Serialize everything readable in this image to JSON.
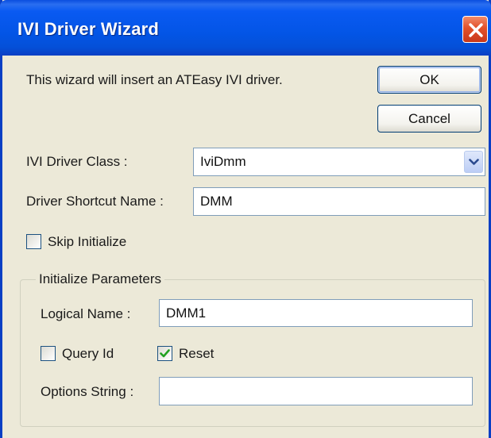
{
  "window": {
    "title": "IVI Driver Wizard"
  },
  "intro_text": "This wizard will insert an ATEasy IVI driver.",
  "buttons": {
    "ok": "OK",
    "cancel": "Cancel"
  },
  "driver_class": {
    "label": "IVI Driver Class :",
    "value": "IviDmm"
  },
  "shortcut_name": {
    "label": "Driver Shortcut Name :",
    "value": "DMM"
  },
  "skip_initialize": {
    "label": "Skip Initialize",
    "checked": false
  },
  "initialize_parameters": {
    "title": "Initialize Parameters",
    "logical_name": {
      "label": "Logical Name :",
      "value": "DMM1"
    },
    "query_id": {
      "label": "Query Id",
      "checked": false
    },
    "reset": {
      "label": "Reset",
      "checked": true
    },
    "options_string": {
      "label": "Options String :",
      "value": ""
    }
  },
  "colors": {
    "titlebar": "#0355e6",
    "window_bg": "#ece9d8",
    "close_button": "#e2512a",
    "checkmark": "#21a121"
  },
  "icons": {
    "close": "close-icon",
    "dropdown": "chevron-down-icon",
    "checkmark": "checkmark-icon"
  }
}
